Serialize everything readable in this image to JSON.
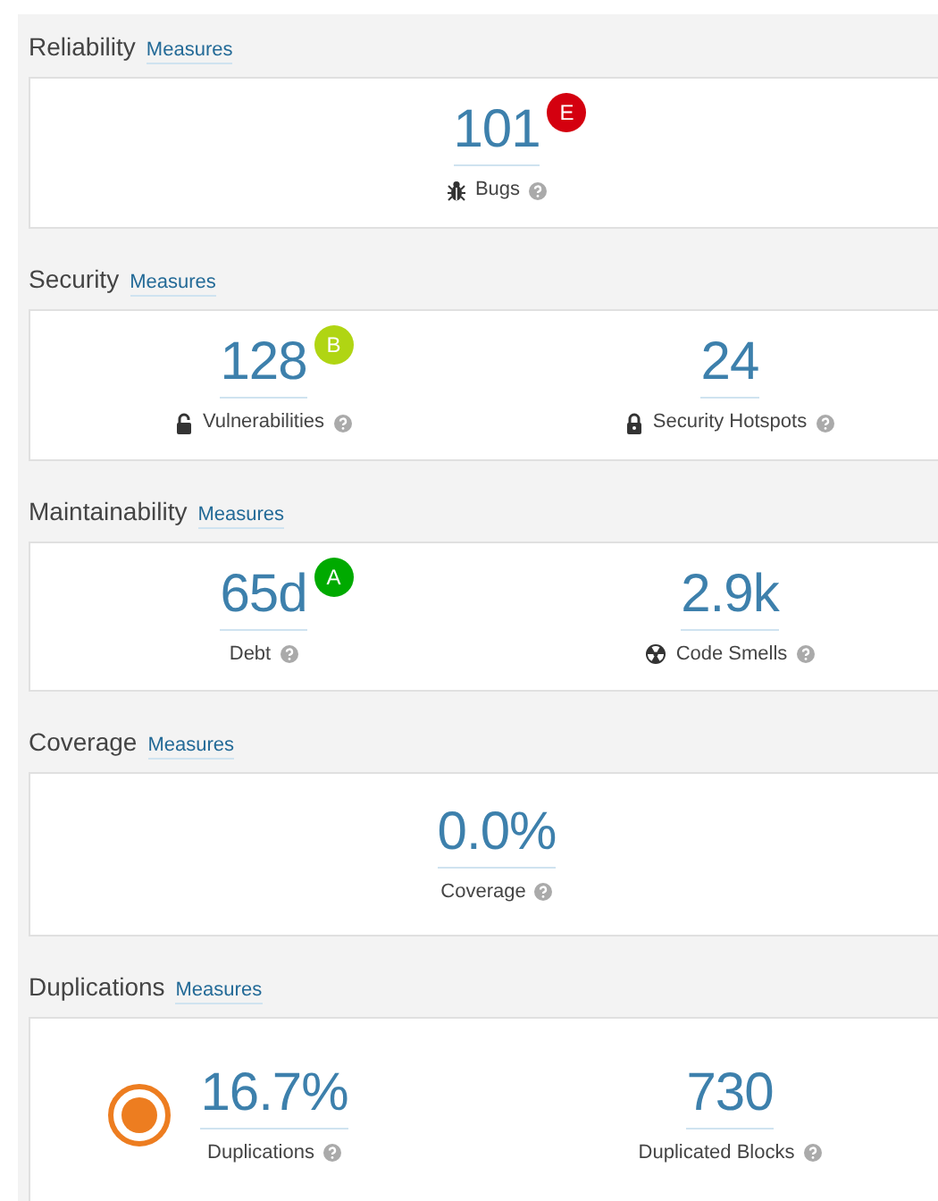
{
  "sections": [
    {
      "title": "Reliability",
      "link": "Measures",
      "metrics": [
        {
          "value": "101",
          "label": "Bugs",
          "kind": "bugs",
          "rating": "E",
          "color": "#d4000f"
        }
      ]
    },
    {
      "title": "Security",
      "link": "Measures",
      "metrics": [
        {
          "value": "128",
          "label": "Vulnerabilities",
          "kind": "vulnerabilities",
          "rating": "B",
          "color": "#b0d513"
        },
        {
          "value": "24",
          "label": "Security Hotspots",
          "kind": "hotspots"
        }
      ]
    },
    {
      "title": "Maintainability",
      "link": "Measures",
      "metrics": [
        {
          "value": "65d",
          "label": "Debt",
          "rating": "A",
          "color": "#00aa00"
        },
        {
          "value": "2.9k",
          "label": "Code Smells",
          "kind": "code_smells"
        }
      ]
    },
    {
      "title": "Coverage",
      "link": "Measures",
      "metrics": [
        {
          "value": "0.0%",
          "label": "Coverage"
        }
      ]
    },
    {
      "title": "Duplications",
      "link": "Measures",
      "metrics": [
        {
          "value": "16.7%",
          "label": "Duplications",
          "kind": "duplications"
        },
        {
          "value": "730",
          "label": "Duplicated Blocks"
        }
      ]
    }
  ]
}
